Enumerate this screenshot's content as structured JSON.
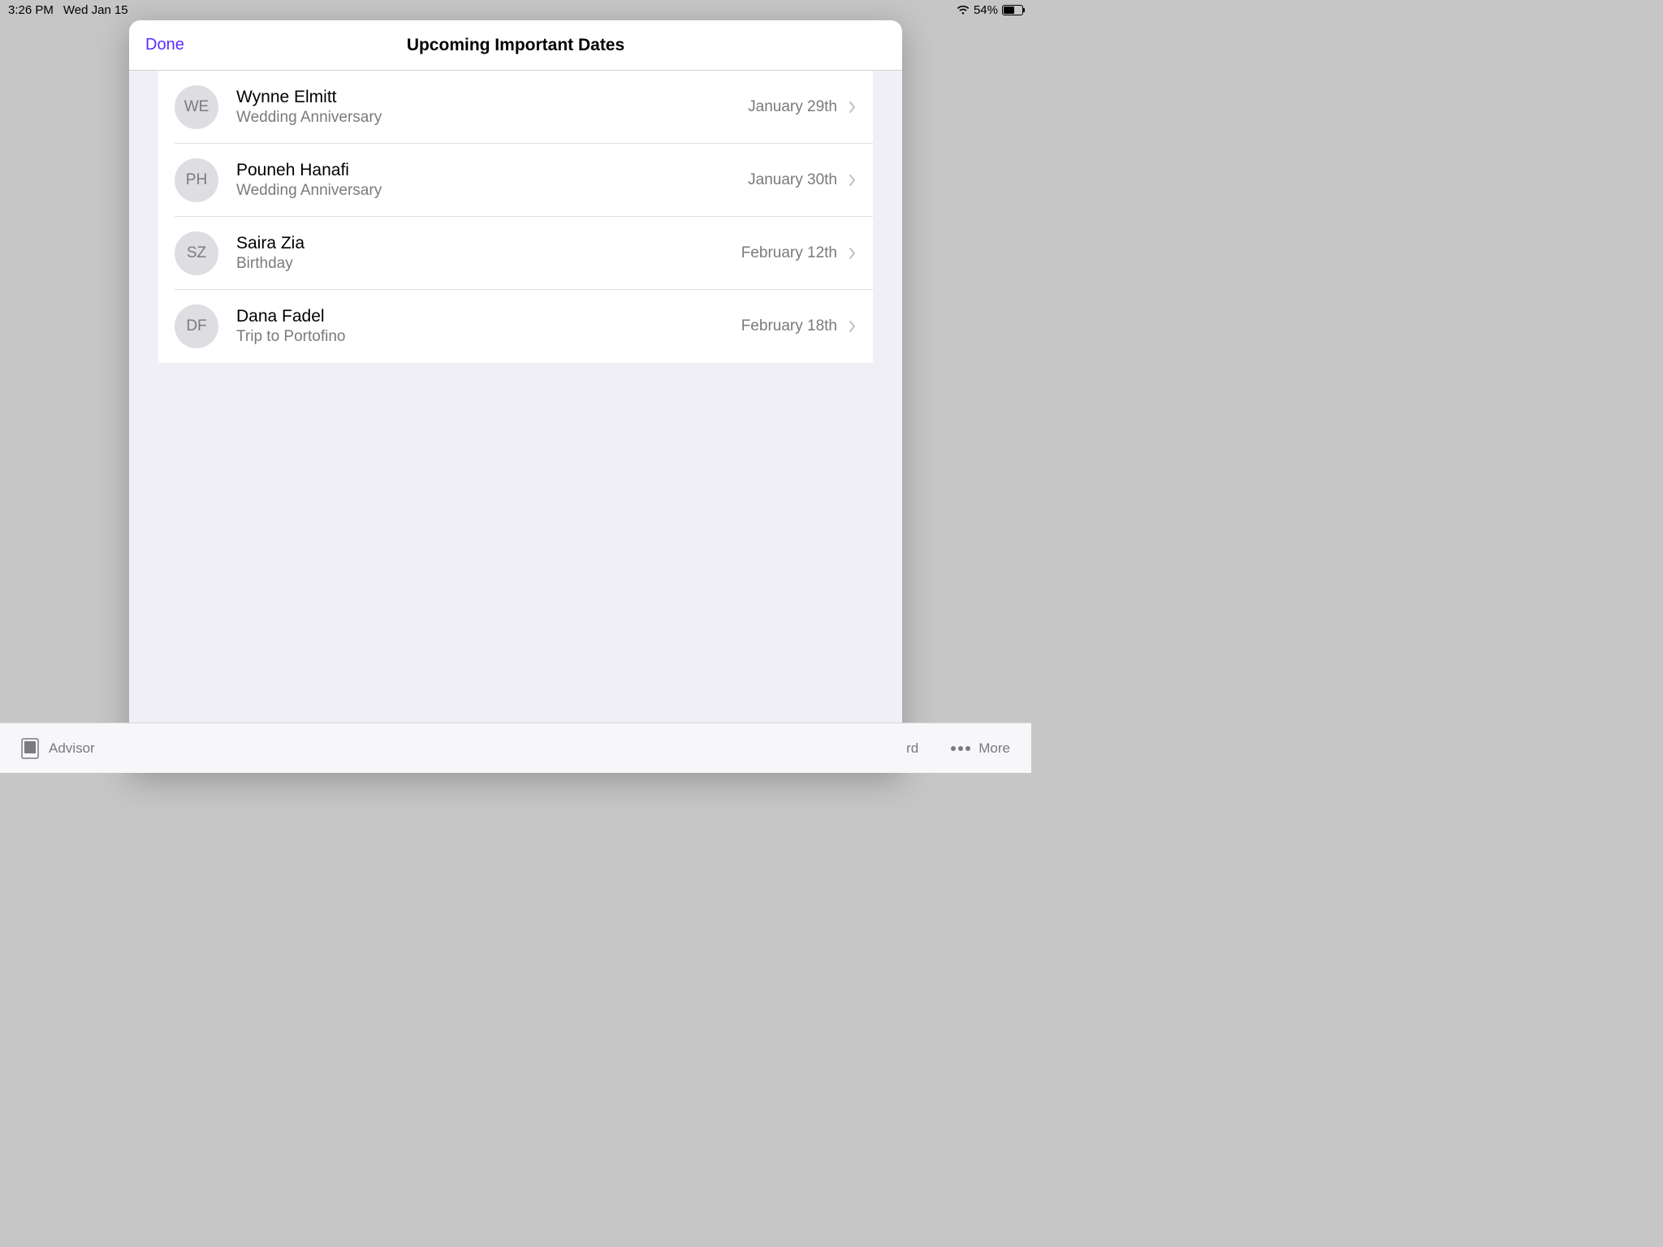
{
  "status": {
    "time": "3:26 PM",
    "date": "Wed Jan 15",
    "battery": "54%"
  },
  "modal": {
    "done_label": "Done",
    "title": "Upcoming Important Dates",
    "rows": [
      {
        "initials": "WE",
        "name": "Wynne Elmitt",
        "event": "Wedding Anniversary",
        "date": "January 29th"
      },
      {
        "initials": "PH",
        "name": "Pouneh Hanafi",
        "event": "Wedding Anniversary",
        "date": "January 30th"
      },
      {
        "initials": "SZ",
        "name": "Saira Zia",
        "event": "Birthday",
        "date": "February 12th"
      },
      {
        "initials": "DF",
        "name": "Dana Fadel",
        "event": "Trip to Portofino",
        "date": "February 18th"
      }
    ]
  },
  "bottombar": {
    "advisor": "Advisor",
    "fragment": "rd",
    "more": "More"
  }
}
